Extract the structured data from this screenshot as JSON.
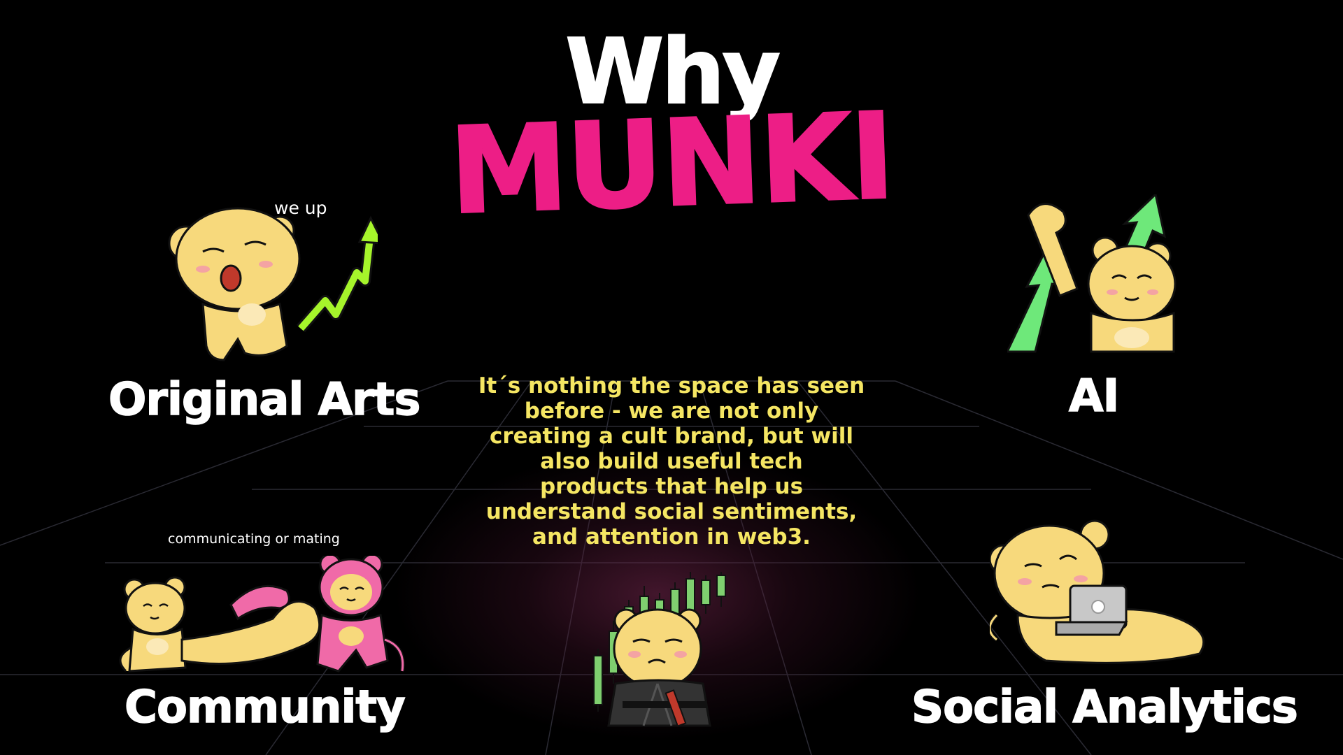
{
  "header": {
    "line1": "Why",
    "line2": "MUNKI"
  },
  "features": {
    "original_arts": {
      "label": "Original Arts",
      "caption": "we up"
    },
    "ai": {
      "label": "AI"
    },
    "community": {
      "label": "Community",
      "caption": "communicating or mating"
    },
    "social_analytics": {
      "label": "Social Analytics"
    }
  },
  "blurb": {
    "lines": [
      "It´s nothing the space has seen",
      "before - we are not only",
      "creating a cult brand, but will",
      "also build useful tech",
      "products that help us",
      "understand social sentiments,",
      "and attention in web3."
    ]
  },
  "colors": {
    "background": "#000000",
    "title_white": "#ffffff",
    "brand_pink": "#ed1e86",
    "blurb_yellow": "#f5e663",
    "munki_yellow": "#f7d97c",
    "arrow_green": "#6ee87a",
    "arrow_lime": "#a6f52b",
    "candle_green": "#7fcf6f",
    "pink_munki": "#f06aa8"
  },
  "icons": {
    "original_arts": "munki-yawning-with-green-arrow",
    "ai": "munki-cheering-with-green-arrows",
    "community": "munkis-handshake",
    "center": "munki-ninja-with-candles",
    "social_analytics": "munki-with-laptop"
  }
}
